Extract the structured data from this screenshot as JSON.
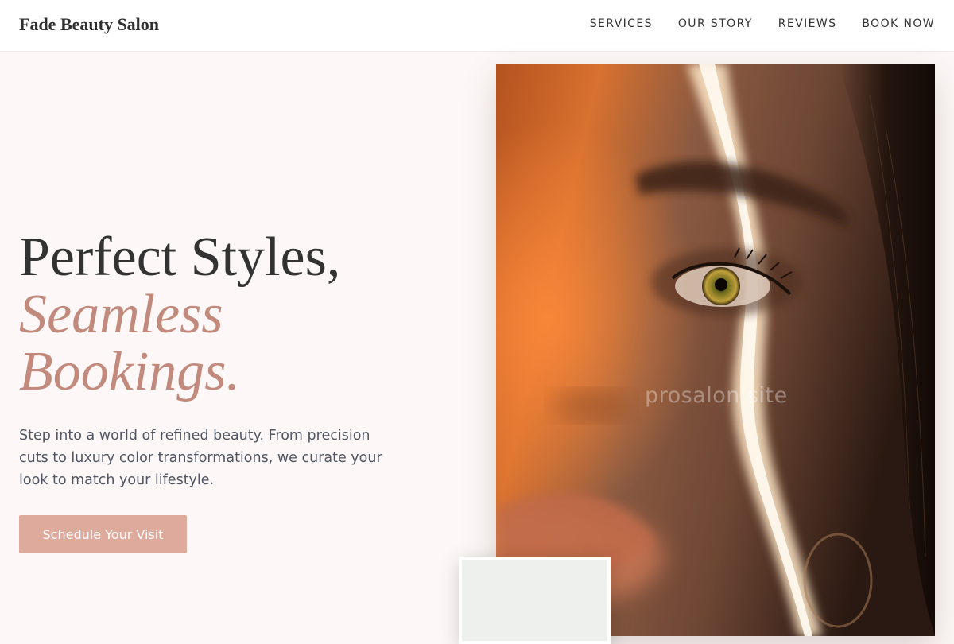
{
  "header": {
    "brand": "Fade Beauty Salon",
    "nav": [
      {
        "label": "SERVICES"
      },
      {
        "label": "OUR STORY"
      },
      {
        "label": "REVIEWS"
      },
      {
        "label": "BOOK NOW"
      }
    ]
  },
  "hero": {
    "headline_line1": "Perfect Styles,",
    "headline_line2": "Seamless",
    "headline_line3": "Bookings.",
    "description": "Step into a world of refined beauty. From precision cuts to luxury color transformations, we curate your look to match your lifestyle.",
    "cta_label": "Schedule Your Visit"
  },
  "image": {
    "watermark": "prosalon.site"
  },
  "colors": {
    "accent": "#c28a7d",
    "button": "#deaa9b",
    "background": "#fdf8f7"
  }
}
